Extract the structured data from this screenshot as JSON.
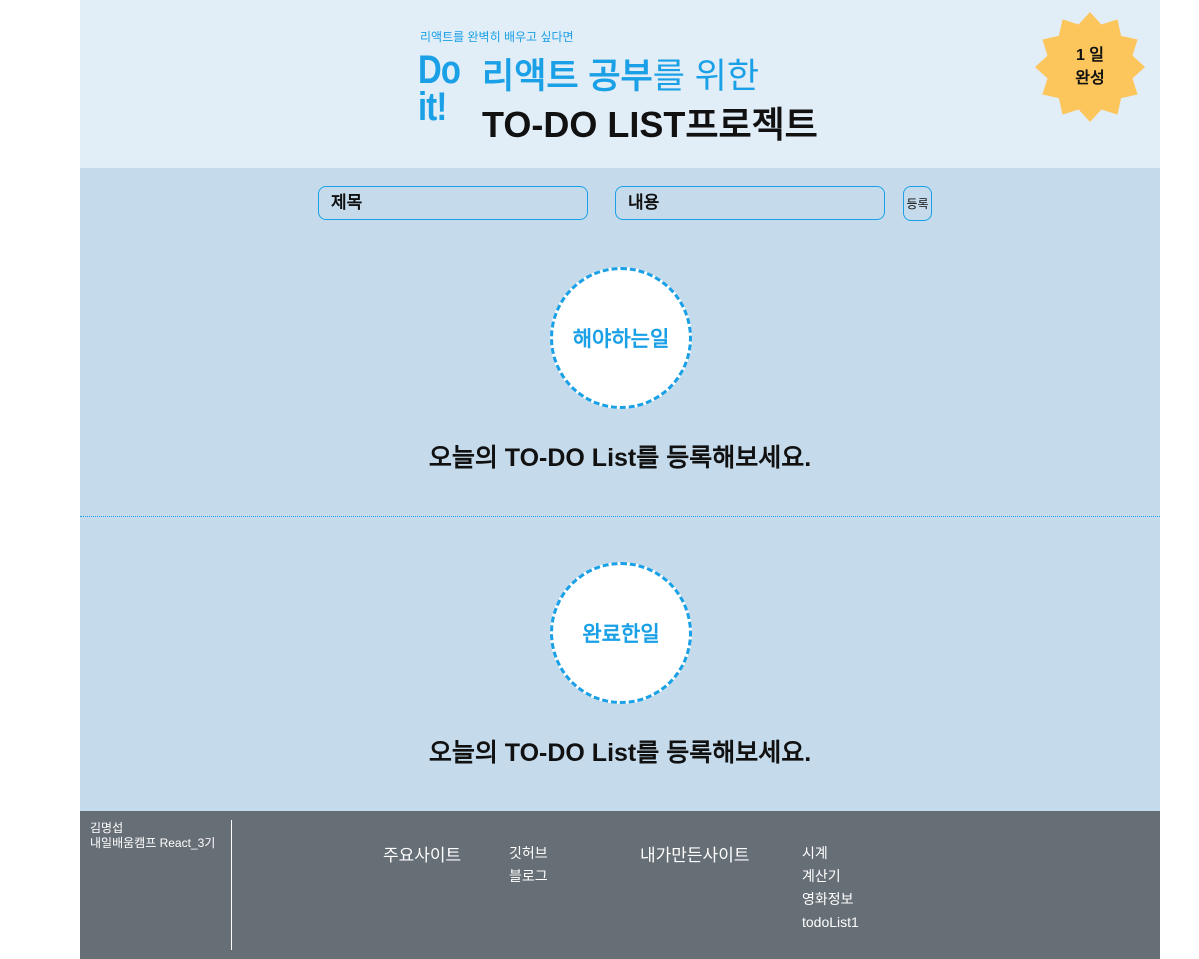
{
  "header": {
    "eyebrow": "리액트를 완벽히 배우고 싶다면",
    "logo_line1": "Do",
    "logo_line2": "it!",
    "headline_strong": "리액트 공부",
    "headline_rest": "를 위한",
    "headline2": "TO-DO LIST프로젝트",
    "badge_line1": "1 일",
    "badge_line2": "완성",
    "badge_color": "#fcc65d"
  },
  "form": {
    "title_placeholder": "제목",
    "content_placeholder": "내용",
    "submit_label": "등록"
  },
  "sections": {
    "todo": {
      "title": "해야하는일",
      "empty_message": "오늘의 TO-DO List를 등록해보세요."
    },
    "done": {
      "title": "완료한일",
      "empty_message": "오늘의 TO-DO List를 등록해보세요."
    }
  },
  "footer": {
    "author_name": "김명섭",
    "author_course": "내일배움캠프 React_3기",
    "main_sites": {
      "title": "주요사이트",
      "links": [
        "깃허브",
        "블로그"
      ]
    },
    "my_sites": {
      "title": "내가만든사이트",
      "links": [
        "시계",
        "계산기",
        "영화정보",
        "todoList1"
      ]
    }
  },
  "colors": {
    "accent": "#1aa0e6",
    "header_bg": "#e1edf7",
    "body_bg": "#c5dbec",
    "footer_bg": "#666e76"
  }
}
